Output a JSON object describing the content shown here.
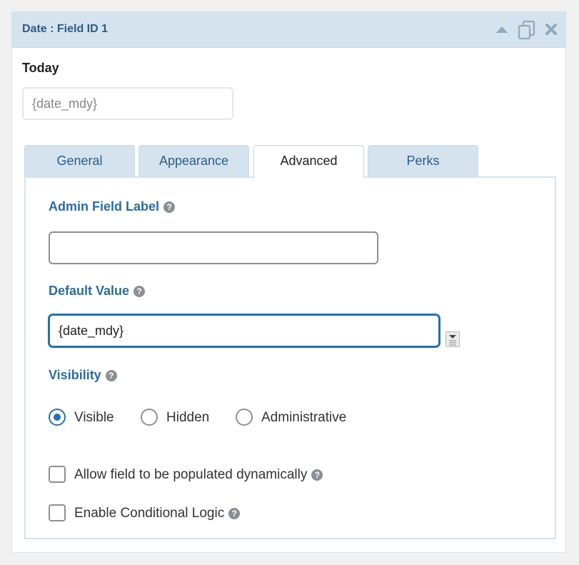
{
  "header": {
    "title": "Date : Field ID 1",
    "icons": [
      "collapse-up-icon",
      "duplicate-icon",
      "close-icon"
    ]
  },
  "field": {
    "label": "Today",
    "preview_value": "{date_mdy}"
  },
  "tabs": [
    {
      "label": "General"
    },
    {
      "label": "Appearance"
    },
    {
      "label": "Advanced",
      "active": true
    },
    {
      "label": "Perks"
    }
  ],
  "advanced": {
    "admin_label": {
      "label": "Admin Field Label",
      "value": ""
    },
    "default_value": {
      "label": "Default Value",
      "value": "{date_mdy}"
    },
    "visibility": {
      "label": "Visibility",
      "options": [
        {
          "label": "Visible",
          "checked": true
        },
        {
          "label": "Hidden",
          "checked": false
        },
        {
          "label": "Administrative",
          "checked": false
        }
      ]
    },
    "dynamic_population": {
      "label": "Allow field to be populated dynamically",
      "checked": false
    },
    "conditional_logic": {
      "label": "Enable Conditional Logic",
      "checked": false
    }
  },
  "help_glyph": "?",
  "colors": {
    "header_bg": "#d5e3ee",
    "header_text": "#2b5d87",
    "accent": "#2271b1",
    "section_label": "#2b6da0"
  }
}
